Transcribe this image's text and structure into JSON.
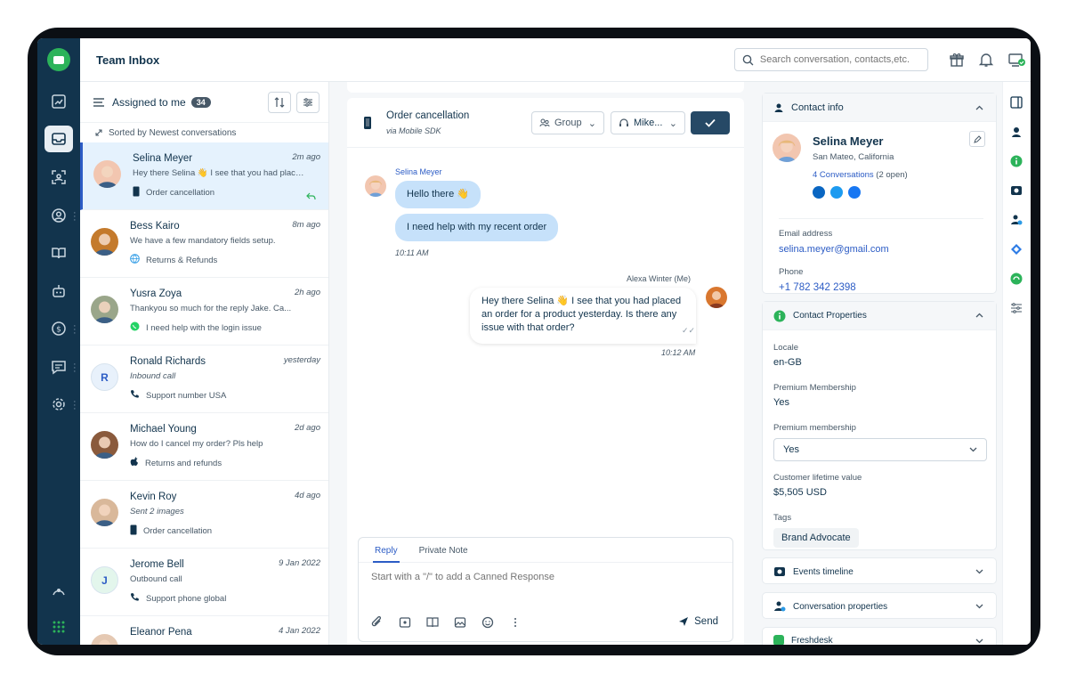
{
  "header": {
    "title": "Team Inbox",
    "search_placeholder": "Search conversation, contacts,etc."
  },
  "list": {
    "filter_label": "Assigned to me",
    "count": "34",
    "sorted_text": "Sorted by Newest conversations",
    "conversations": [
      {
        "name": "Selina Meyer",
        "time": "2m ago",
        "preview": "Hey there Selina 👋 I see that you had placed an order for a product yesterday.",
        "meta": "Order cancellation",
        "channel": "mobile-icon",
        "initial": "",
        "avatar_color": "#f2c6b0"
      },
      {
        "name": "Bess Kairo",
        "time": "8m ago",
        "preview": "We have a few mandatory fields setup.",
        "meta": "Returns & Refunds",
        "channel": "globe-icon",
        "initial": "",
        "avatar_color": "#c47a2c"
      },
      {
        "name": "Yusra Zoya",
        "time": "2h ago",
        "preview": "Thankyou so much for the reply Jake. Ca...",
        "meta": "I need help with the login issue",
        "channel": "whatsapp-icon",
        "initial": "",
        "avatar_color": "#9aa68a"
      },
      {
        "name": "Ronald Richards",
        "time": "yesterday",
        "preview": "Inbound call",
        "meta": "Support number USA",
        "channel": "phone-icon",
        "initial": "R",
        "avatar_color": "#e8f1fb"
      },
      {
        "name": "Michael Young",
        "time": "2d ago",
        "preview": "How do I cancel my order? Pls help",
        "meta": "Returns and refunds",
        "channel": "apple-icon",
        "initial": "",
        "avatar_color": "#8a5a3c"
      },
      {
        "name": "Kevin Roy",
        "time": "4d ago",
        "preview": "Sent 2 images",
        "meta": "Order cancellation",
        "channel": "mobile-icon",
        "initial": "",
        "avatar_color": "#d9b89a"
      },
      {
        "name": "Jerome Bell",
        "time": "9 Jan 2022",
        "preview": "Outbound call",
        "meta": "Support phone global",
        "channel": "phone-icon",
        "initial": "J",
        "avatar_color": "#e3f6ec"
      },
      {
        "name": "Eleanor Pena",
        "time": "4 Jan 2022",
        "preview": "",
        "meta": "",
        "channel": "",
        "initial": "",
        "avatar_color": "#e5c9b3"
      }
    ]
  },
  "chat": {
    "title": "Order cancellation",
    "subtitle": "via Mobile SDK",
    "group_label": "Group",
    "agent_label": "Mike...",
    "sender_name": "Selina Meyer",
    "msg1": "Hello there 👋",
    "msg2": "I need help with my recent order",
    "time1": "10:11 AM",
    "agent_name": "Alexa Winter (Me)",
    "reply_msg": "Hey there Selina 👋 I see that you had placed an order for a product yesterday. Is there any issue with that order?",
    "time2": "10:12 AM",
    "tab_reply": "Reply",
    "tab_note": "Private Note",
    "composer_placeholder": "Start with a \"/\" to add a Canned Response",
    "send_label": "Send"
  },
  "contact": {
    "header": "Contact info",
    "name": "Selina Meyer",
    "location": "San Mateo, California",
    "conversations_link": "4 Conversations",
    "conversations_open": "(2 open)",
    "email_label": "Email address",
    "email": "selina.meyer@gmail.com",
    "phone_label": "Phone",
    "phone": "+1 782 342 2398"
  },
  "properties": {
    "header": "Contact Properties",
    "locale_label": "Locale",
    "locale": "en-GB",
    "premium_label": "Premium Membership",
    "premium": "Yes",
    "premium2_label": "Premium membership",
    "premium2": "Yes",
    "clv_label": "Customer lifetime value",
    "clv": "$5,505 USD",
    "tags_label": "Tags",
    "tag": "Brand Advocate"
  },
  "sections": {
    "events": "Events timeline",
    "conv_props": "Conversation properties",
    "freshdesk": "Freshdesk"
  },
  "colors": {
    "accent": "#2c5cc5",
    "rail": "#12344d",
    "bubble_in": "#c6e1fa"
  }
}
